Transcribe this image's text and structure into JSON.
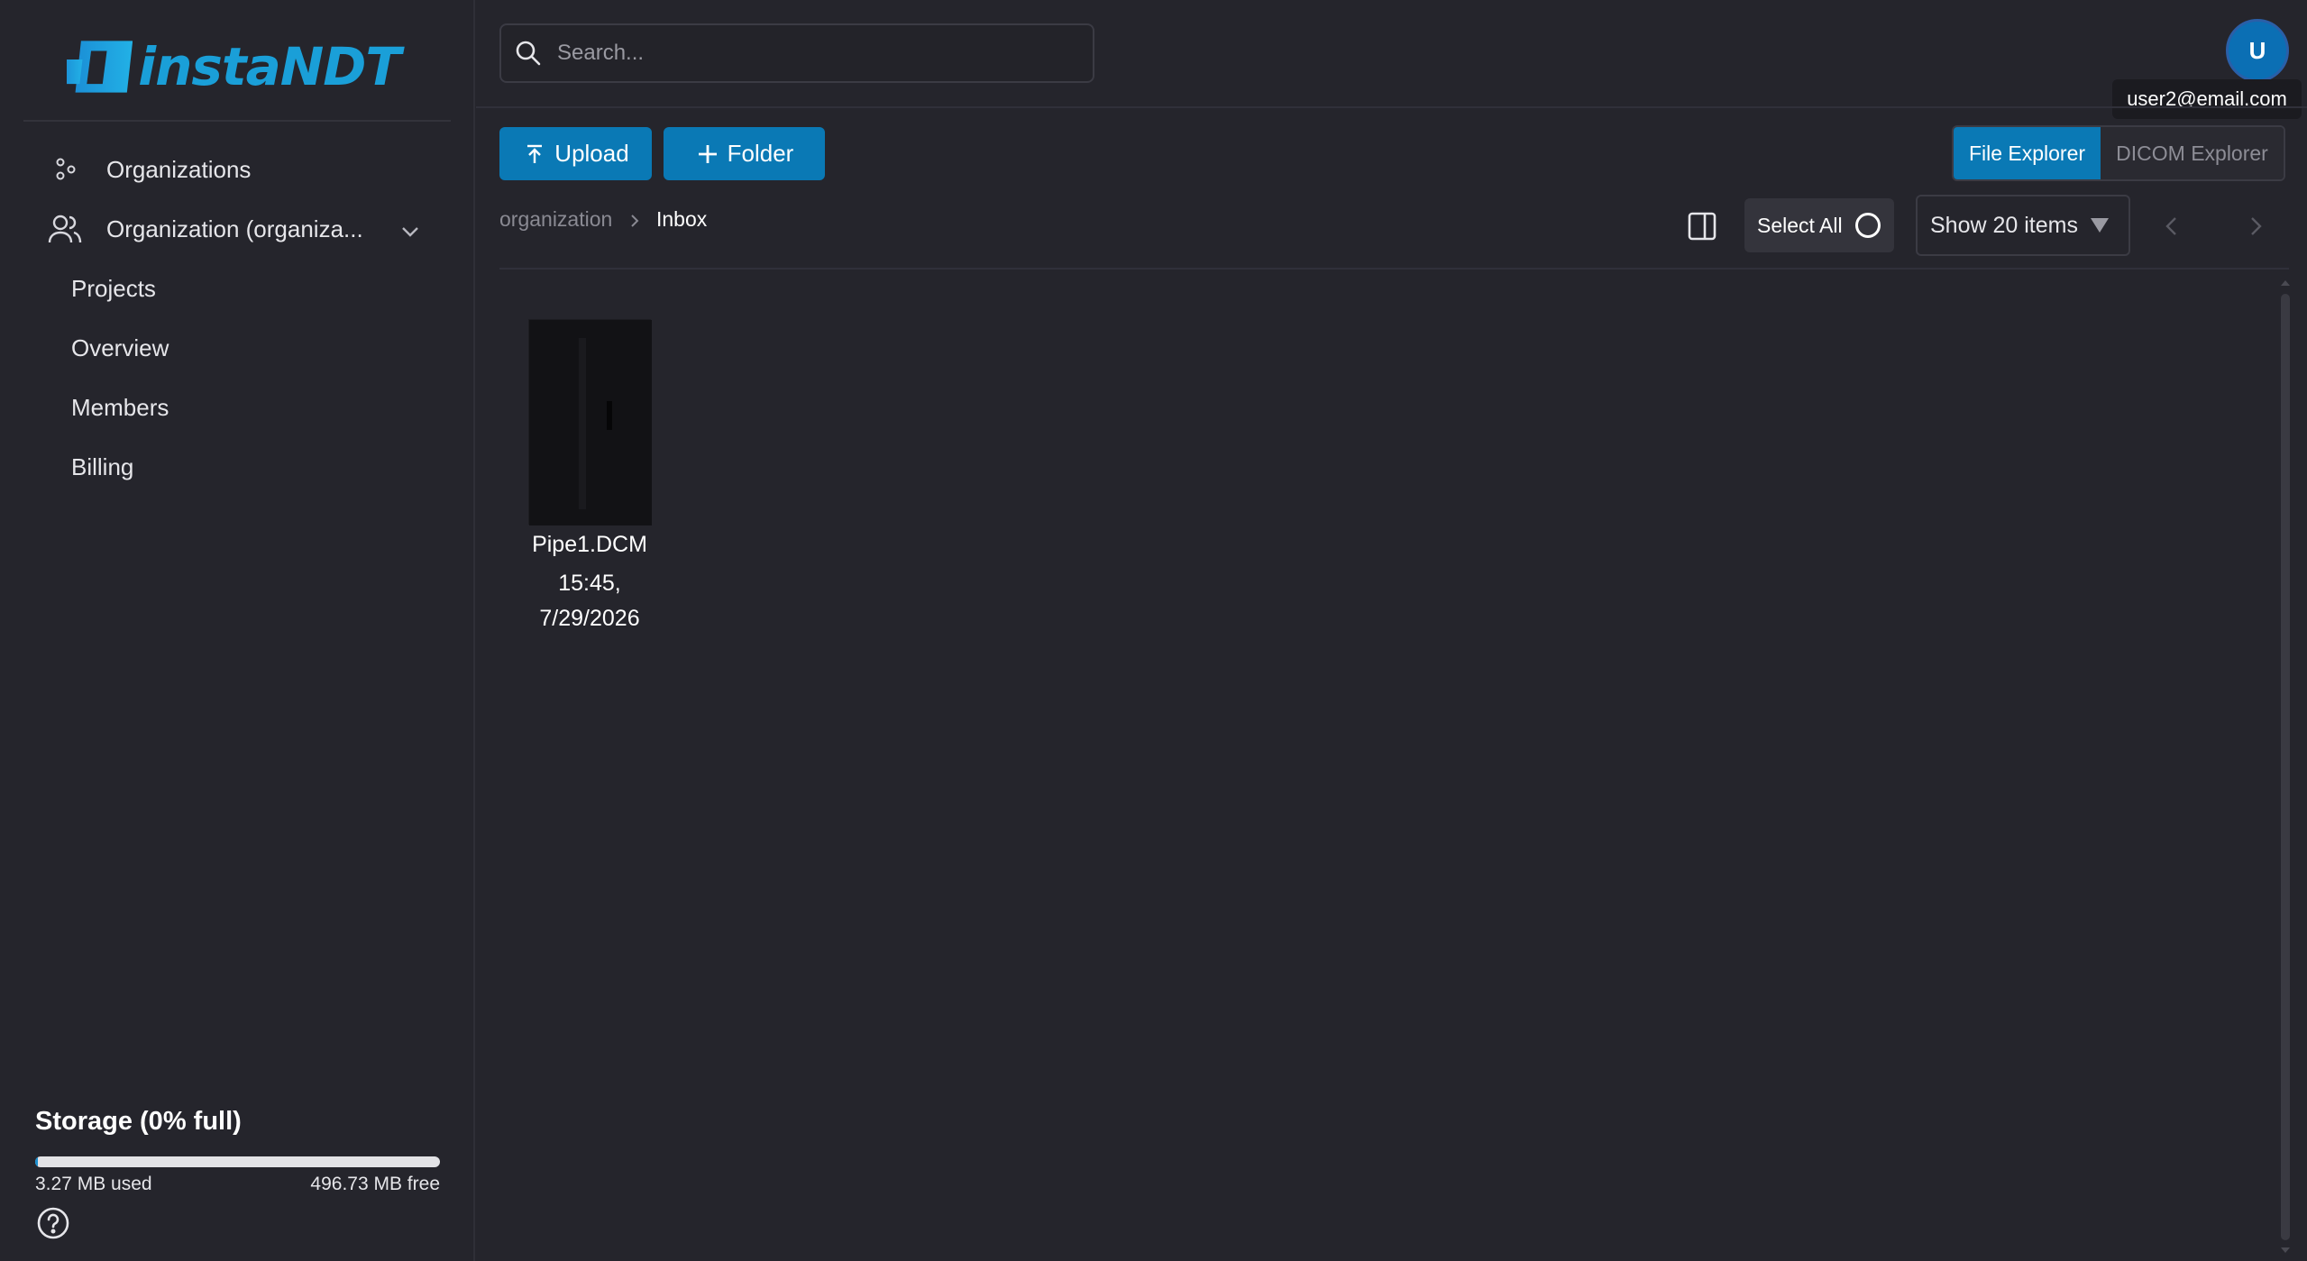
{
  "app": {
    "logo_text": "instaNDT"
  },
  "sidebar": {
    "items": [
      {
        "label": "Organizations",
        "icon": "organizations-icon"
      },
      {
        "label": "Organization (organiza...",
        "icon": "users-icon"
      }
    ],
    "subitems": [
      "Projects",
      "Overview",
      "Members",
      "Billing"
    ],
    "storage": {
      "title": "Storage (0% full)",
      "used": "3.27 MB used",
      "free": "496.73 MB free",
      "percent": 0
    }
  },
  "header": {
    "search_placeholder": "Search...",
    "avatar_initial": "U",
    "user_email": "user2@email.com"
  },
  "toolbar": {
    "upload_label": "Upload",
    "folder_label": "Folder",
    "view_tabs": [
      "File Explorer",
      "DICOM Explorer"
    ],
    "active_view": "File Explorer",
    "select_all_label": "Select All",
    "show_items_label": "Show 20 items"
  },
  "breadcrumb": [
    "organization",
    "Inbox"
  ],
  "files": [
    {
      "name": "Pipe1.DCM",
      "time": "15:45,",
      "date": "7/29/2026"
    }
  ],
  "colors": {
    "accent": "#0a79b5",
    "background": "#25252c",
    "logo": "#1a9fd8"
  }
}
